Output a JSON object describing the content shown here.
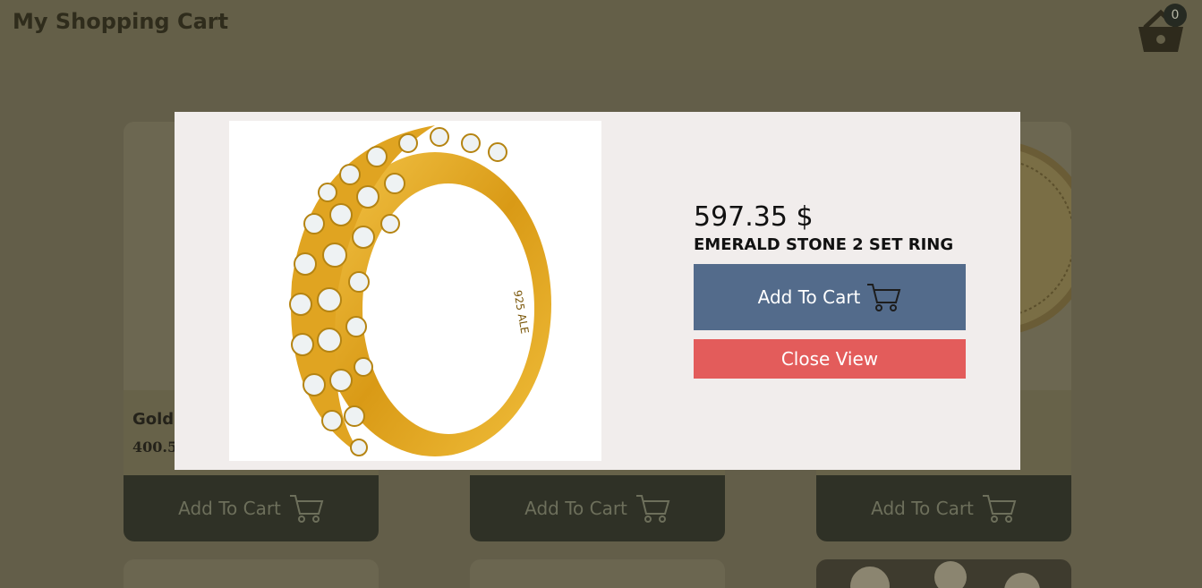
{
  "header": {
    "title": "My Shopping Cart",
    "cart_count": "0"
  },
  "cards": [
    {
      "name": "Gold",
      "price": "400.5",
      "button_label": "Add To Cart"
    },
    {
      "button_label": "Add To Cart"
    },
    {
      "button_label": "Add To Cart"
    }
  ],
  "modal": {
    "price": "597.35 $",
    "name": "EMERALD STONE 2 SET RING",
    "add_label": "Add To Cart",
    "close_label": "Close View"
  },
  "icons": {
    "basket": "basket-icon",
    "cart": "shopping-cart-icon",
    "product": "gold-ring-image"
  },
  "colors": {
    "overlay": "#635e49",
    "modal_bg": "#f1edec",
    "add_button": "#536b8b",
    "close_button": "#e35c5b"
  }
}
